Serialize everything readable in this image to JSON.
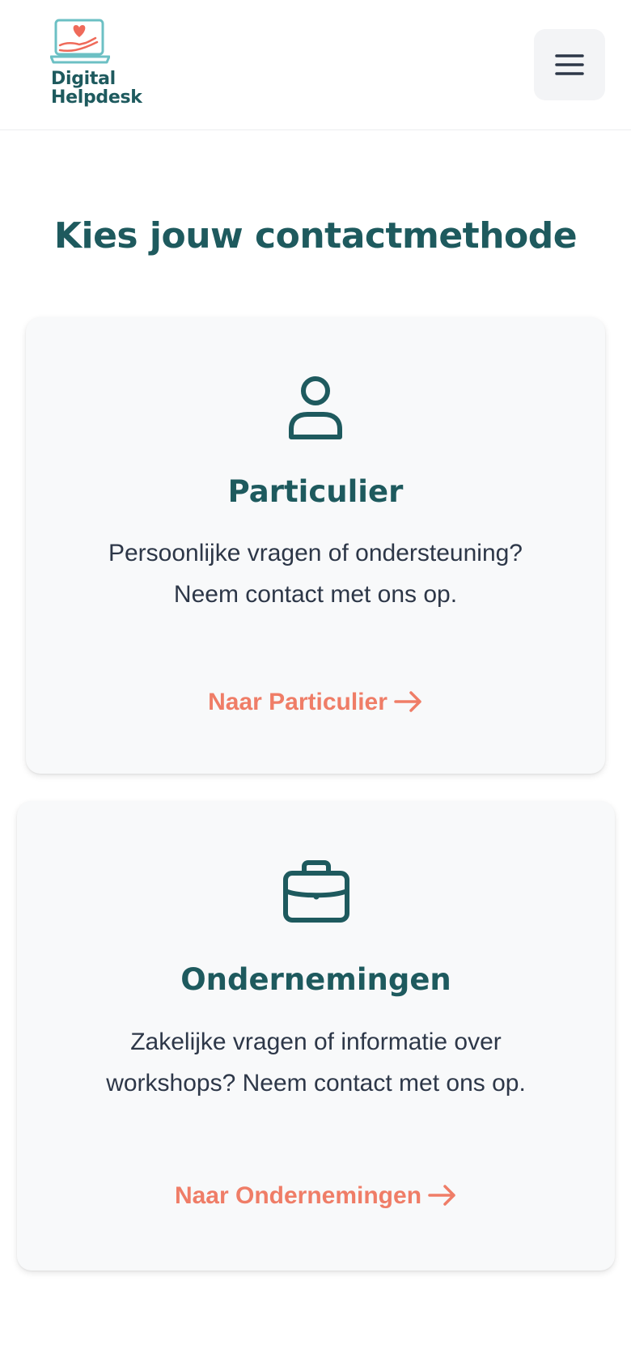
{
  "header": {
    "logo": {
      "line1": "Digital",
      "line2": "Helpdesk",
      "icon": "laptop-heart-hand-icon"
    },
    "menu_icon": "hamburger-menu-icon"
  },
  "main": {
    "title": "Kies jouw contactmethode",
    "cards": [
      {
        "icon": "user-icon",
        "title": "Particulier",
        "description": "Persoonlijke vragen of ondersteuning? Neem contact met ons op.",
        "link_label": "Naar Particulier",
        "link_icon": "arrow-right-icon"
      },
      {
        "icon": "briefcase-icon",
        "title": "Ondernemingen",
        "description": "Zakelijke vragen of informatie over workshops? Neem contact met ons op.",
        "link_label": "Naar Ondernemingen",
        "link_icon": "arrow-right-icon"
      }
    ]
  },
  "colors": {
    "brand_teal": "#1e5a5e",
    "accent_coral": "#ef7d67",
    "card_background": "#f8f9fa",
    "body_text": "#2d3748"
  }
}
